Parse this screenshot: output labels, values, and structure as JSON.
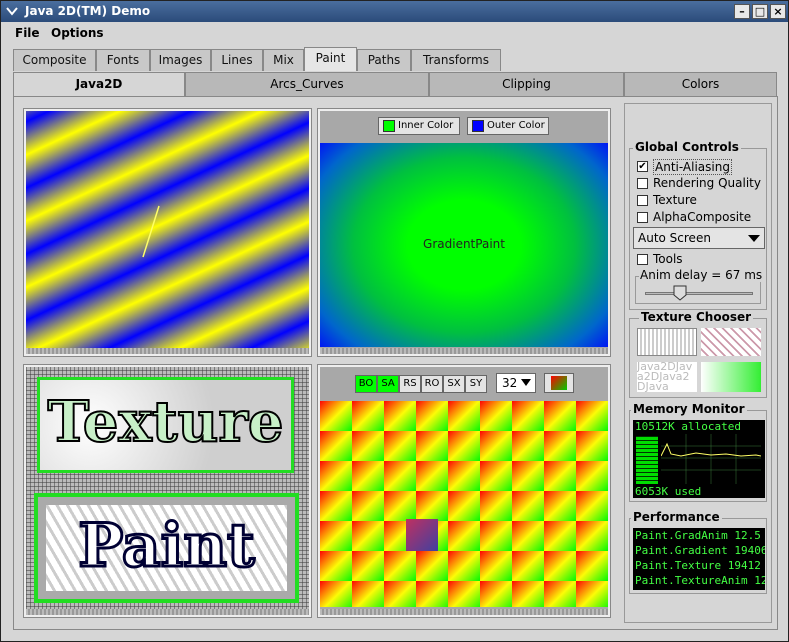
{
  "window": {
    "title": "Java 2D(TM) Demo"
  },
  "menubar": {
    "file": "File",
    "options": "Options"
  },
  "tabs_main": [
    "Composite",
    "Fonts",
    "Images",
    "Lines",
    "Mix",
    "Paint",
    "Paths",
    "Transforms"
  ],
  "tabs_sub": [
    "Java2D",
    "Arcs_Curves",
    "Clipping",
    "Colors"
  ],
  "gradient_panel": {
    "inner_label": "Inner Color",
    "outer_label": "Outer Color",
    "center_text": "GradientPaint",
    "inner_color": "#00ff00",
    "outer_color": "#0000ff"
  },
  "texture_panel": {
    "word1": "Texture",
    "word2": "Paint"
  },
  "grid_panel": {
    "toggles": [
      "BO",
      "SA",
      "RS",
      "RO",
      "SX",
      "SY"
    ],
    "active_toggles": [
      "BO",
      "SA"
    ],
    "size_value": "32"
  },
  "global_controls": {
    "title": "Global Controls",
    "antialias": "Anti-Aliasing",
    "quality": "Rendering Quality",
    "texture": "Texture",
    "alpha": "AlphaComposite",
    "screen": "Auto Screen",
    "tools": "Tools",
    "delay": "Anim delay = 67 ms"
  },
  "texture_chooser": {
    "title": "Texture Chooser",
    "sample_text": "Java2DJava2DJava2DJava"
  },
  "memory": {
    "title": "Memory Monitor",
    "allocated": "10512K allocated",
    "used": "6053K used"
  },
  "performance": {
    "title": "Performance",
    "lines": [
      "Paint.GradAnim 12.5 f",
      "Paint.Gradient 19406",
      "Paint.Texture 19412 m",
      "Paint.TextureAnim 12."
    ]
  }
}
